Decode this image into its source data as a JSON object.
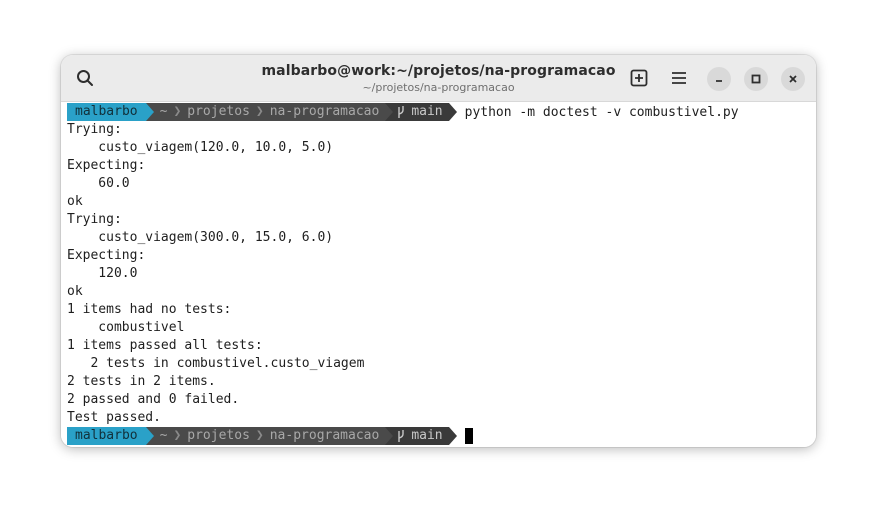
{
  "window": {
    "title": "malbarbo@work:~/projetos/na-programacao",
    "subtitle": "~/projetos/na-programacao"
  },
  "titlebar_icons": {
    "search": "search-icon",
    "new_tab": "new-tab-icon",
    "menu": "hamburger-menu-icon",
    "minimize": "minimize-icon",
    "maximize": "maximize-icon",
    "close": "close-icon"
  },
  "prompt": {
    "user": "malbarbo",
    "home": "~",
    "dir1": "projetos",
    "dir2": "na-programacao",
    "branch_icon": "git-branch-icon",
    "branch": "main"
  },
  "command": "python -m doctest -v combustivel.py",
  "output": [
    "Trying:",
    "    custo_viagem(120.0, 10.0, 5.0)",
    "Expecting:",
    "    60.0",
    "ok",
    "Trying:",
    "    custo_viagem(300.0, 15.0, 6.0)",
    "Expecting:",
    "    120.0",
    "ok",
    "1 items had no tests:",
    "    combustivel",
    "1 items passed all tests:",
    "   2 tests in combustivel.custo_viagem",
    "2 tests in 2 items.",
    "2 passed and 0 failed.",
    "Test passed."
  ],
  "colors": {
    "user_segment": "#2aa1c8",
    "path_segment": "#4a4a4a",
    "git_segment": "#3a3a3a"
  }
}
